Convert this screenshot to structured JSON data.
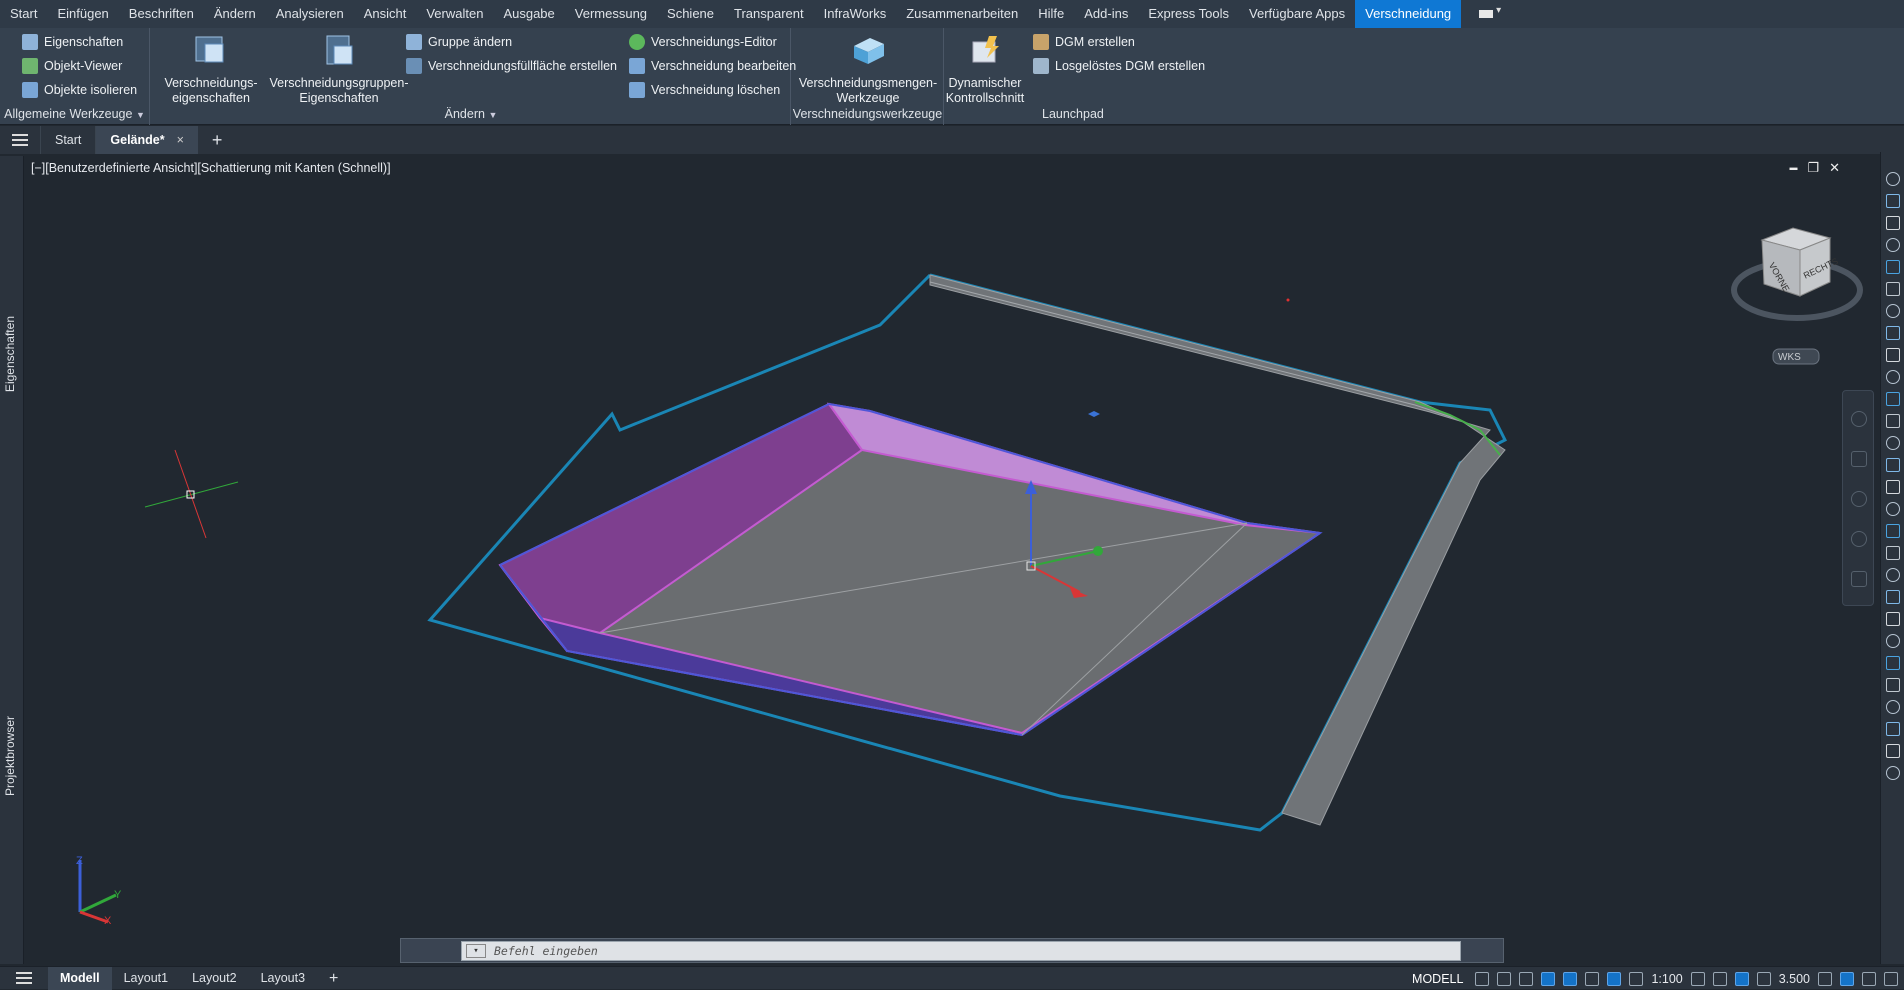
{
  "menubar": {
    "tabs": [
      "Start",
      "Einfügen",
      "Beschriften",
      "Ändern",
      "Analysieren",
      "Ansicht",
      "Verwalten",
      "Ausgabe",
      "Vermessung",
      "Schiene",
      "Transparent",
      "InfraWorks",
      "Zusammenarbeiten",
      "Hilfe",
      "Add-ins",
      "Express Tools",
      "Verfügbare Apps",
      "Verschneidung"
    ],
    "active_tab": "Verschneidung"
  },
  "ribbon": {
    "general": {
      "title": "Allgemeine Werkzeuge",
      "items": [
        "Eigenschaften",
        "Objekt-Viewer",
        "Objekte isolieren"
      ]
    },
    "aendern": {
      "title": "Ändern",
      "big1": "Verschneidungs-\neigenschaften",
      "big2": "Verschneidungsgruppen-\nEigenschaften",
      "small1": "Gruppe ändern",
      "small2": "Verschneidungsfüllfläche erstellen",
      "small3": "Verschneidungs-Editor",
      "small4": "Verschneidung bearbeiten",
      "small5": "Verschneidung löschen"
    },
    "werkzeuge": {
      "title": "Verschneidungswerkzeuge",
      "big": "Verschneidungsmengen-\nWerkzeuge"
    },
    "launchpad": {
      "title": "Launchpad",
      "big": "Dynamischer\nKontrollschnitt",
      "small1": "DGM erstellen",
      "small2": "Losgelöstes DGM erstellen"
    }
  },
  "filetabs": {
    "start": "Start",
    "active": "Gelände*",
    "close": "×",
    "plus": "+"
  },
  "viewport": {
    "label": "[−][Benutzerdefinierte Ansicht][Schattierung mit Kanten (Schnell)]",
    "viewcube_front": "VORNE",
    "viewcube_right": "RECHTS",
    "wcs": "WKS",
    "axis_z": "Z",
    "axis_y": "Y",
    "axis_x": "X",
    "controls": {
      "min": "▬",
      "restore": "❐",
      "close": "✕"
    }
  },
  "leftpanels": {
    "top": "Eigenschaften",
    "bottom": "Projektbrowser"
  },
  "command": {
    "placeholder": "Befehl eingeben"
  },
  "statusbar": {
    "layouts": [
      "Modell",
      "Layout1",
      "Layout2",
      "Layout3"
    ],
    "active_layout": "Modell",
    "mode": "MODELL",
    "scale": "1:100",
    "elevation": "3.500"
  }
}
